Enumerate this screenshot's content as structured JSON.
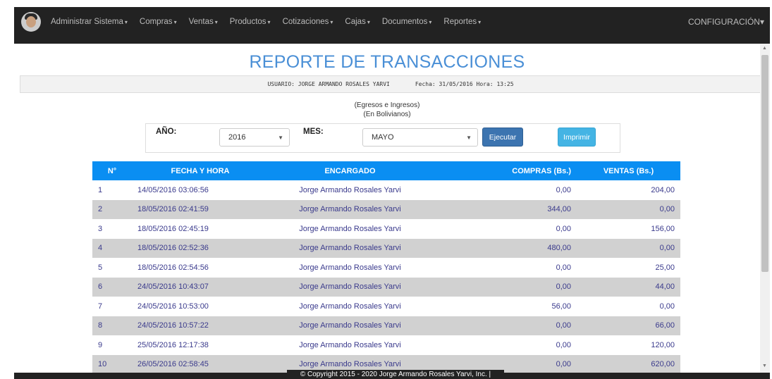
{
  "navbar": {
    "items": [
      "Administrar Sistema",
      "Compras",
      "Ventas",
      "Productos",
      "Cotizaciones",
      "Cajas",
      "Documentos",
      "Reportes"
    ],
    "right": "CONFIGURACIÓN"
  },
  "report": {
    "title": "REPORTE DE TRANSACCIONES",
    "user_line": "USUARIO: JORGE ARMANDO ROSALES YARVI",
    "date_line": "Fecha: 31/05/2016 Hora: 13:25",
    "subtitle1": "(Egresos e Ingresos)",
    "subtitle2": "(En Bolivianos)"
  },
  "filters": {
    "year_label": "AÑO:",
    "year_value": "2016",
    "month_label": "MES:",
    "month_value": "MAYO",
    "execute_label": "Ejecutar",
    "print_label": "Imprimir"
  },
  "table": {
    "headers": [
      "N°",
      "FECHA Y HORA",
      "ENCARGADO",
      "COMPRAS (Bs.)",
      "VENTAS (Bs.)"
    ],
    "rows": [
      [
        "1",
        "14/05/2016 03:06:56",
        "Jorge Armando Rosales Yarvi",
        "0,00",
        "204,00"
      ],
      [
        "2",
        "18/05/2016 02:41:59",
        "Jorge Armando Rosales Yarvi",
        "344,00",
        "0,00"
      ],
      [
        "3",
        "18/05/2016 02:45:19",
        "Jorge Armando Rosales Yarvi",
        "0,00",
        "156,00"
      ],
      [
        "4",
        "18/05/2016 02:52:36",
        "Jorge Armando Rosales Yarvi",
        "480,00",
        "0,00"
      ],
      [
        "5",
        "18/05/2016 02:54:56",
        "Jorge Armando Rosales Yarvi",
        "0,00",
        "25,00"
      ],
      [
        "6",
        "24/05/2016 10:43:07",
        "Jorge Armando Rosales Yarvi",
        "0,00",
        "44,00"
      ],
      [
        "7",
        "24/05/2016 10:53:00",
        "Jorge Armando Rosales Yarvi",
        "56,00",
        "0,00"
      ],
      [
        "8",
        "24/05/2016 10:57:22",
        "Jorge Armando Rosales Yarvi",
        "0,00",
        "66,00"
      ],
      [
        "9",
        "25/05/2016 12:17:38",
        "Jorge Armando Rosales Yarvi",
        "0,00",
        "120,00"
      ],
      [
        "10",
        "26/05/2016 02:58:45",
        "Jorge Armando Rosales Yarvi",
        "0,00",
        "620,00"
      ]
    ]
  },
  "footer": {
    "text": "© Copyright 2015 - 2020 Jorge Armando Rosales Yarvi, Inc. |"
  }
}
